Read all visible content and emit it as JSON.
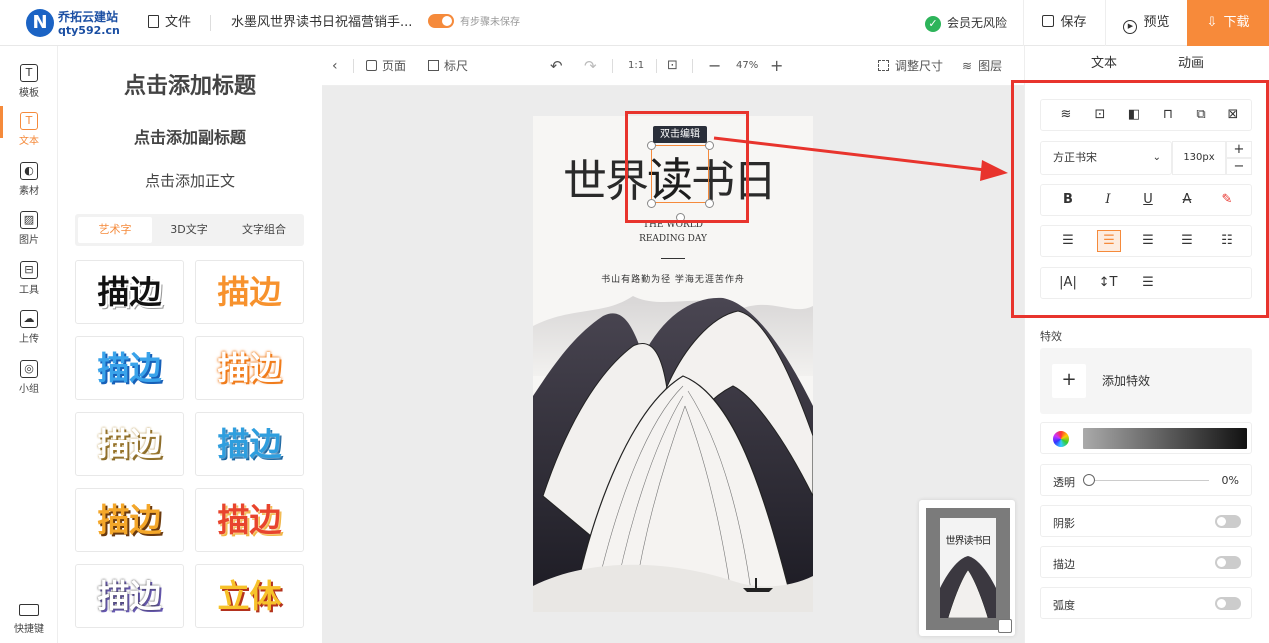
{
  "brand": {
    "name": "乔拓云建站",
    "url": "qty592.cn",
    "logo_letter": "N"
  },
  "topbar": {
    "file_label": "文件",
    "doc_title": "水墨风世界读书日祝福营销手...",
    "autosave_label": "有步骤未保存",
    "risk_label": "会员无风险",
    "save_label": "保存",
    "preview_label": "预览",
    "download_label": "下载"
  },
  "rail": {
    "items": [
      {
        "label": "模板",
        "glyph": "T"
      },
      {
        "label": "文本",
        "glyph": "T"
      },
      {
        "label": "素材",
        "glyph": "◐"
      },
      {
        "label": "图片",
        "glyph": "▨"
      },
      {
        "label": "工具",
        "glyph": "⊟"
      },
      {
        "label": "上传",
        "glyph": "☁"
      },
      {
        "label": "小组",
        "glyph": "◎"
      }
    ],
    "shortcut_label": "快捷键"
  },
  "text_panel": {
    "add_title": "点击添加标题",
    "add_subtitle": "点击添加副标题",
    "add_body": "点击添加正文",
    "tabs": [
      "艺术字",
      "3D文字",
      "文字组合"
    ],
    "art_samples": [
      "描边",
      "描边",
      "描边",
      "描边",
      "描边",
      "描边",
      "描边",
      "描边",
      "描边",
      "立体"
    ]
  },
  "canvas_toolbar": {
    "page_label": "页面",
    "ruler_label": "标尺",
    "ratio_label": "1:1",
    "zoom": "47%",
    "resize_label": "调整尺寸",
    "layers_label": "图层"
  },
  "poster": {
    "title_a": "世界",
    "title_b": "读",
    "title_c": "书日",
    "en_line1": "THE WORLD",
    "en_line2": "READING DAY",
    "slogan": "书山有路勤为径  学海无涯苦作舟"
  },
  "selection": {
    "tooltip": "双击编辑"
  },
  "thumbnail": {
    "title": "世界读书日"
  },
  "right_panel": {
    "tab_text": "文本",
    "tab_animation": "动画",
    "font_family": "方正书宋",
    "font_size": "130px",
    "effects_label": "特效",
    "add_effect_label": "添加特效",
    "opacity_label": "透明",
    "opacity_value": 0,
    "opacity_text": "0%",
    "shadow_label": "阴影",
    "stroke_label": "描边",
    "curve_label": "弧度"
  },
  "colors": {
    "accent": "#f58a3b",
    "annotation_red": "#e8342d",
    "brand_blue": "#1b63c4"
  }
}
